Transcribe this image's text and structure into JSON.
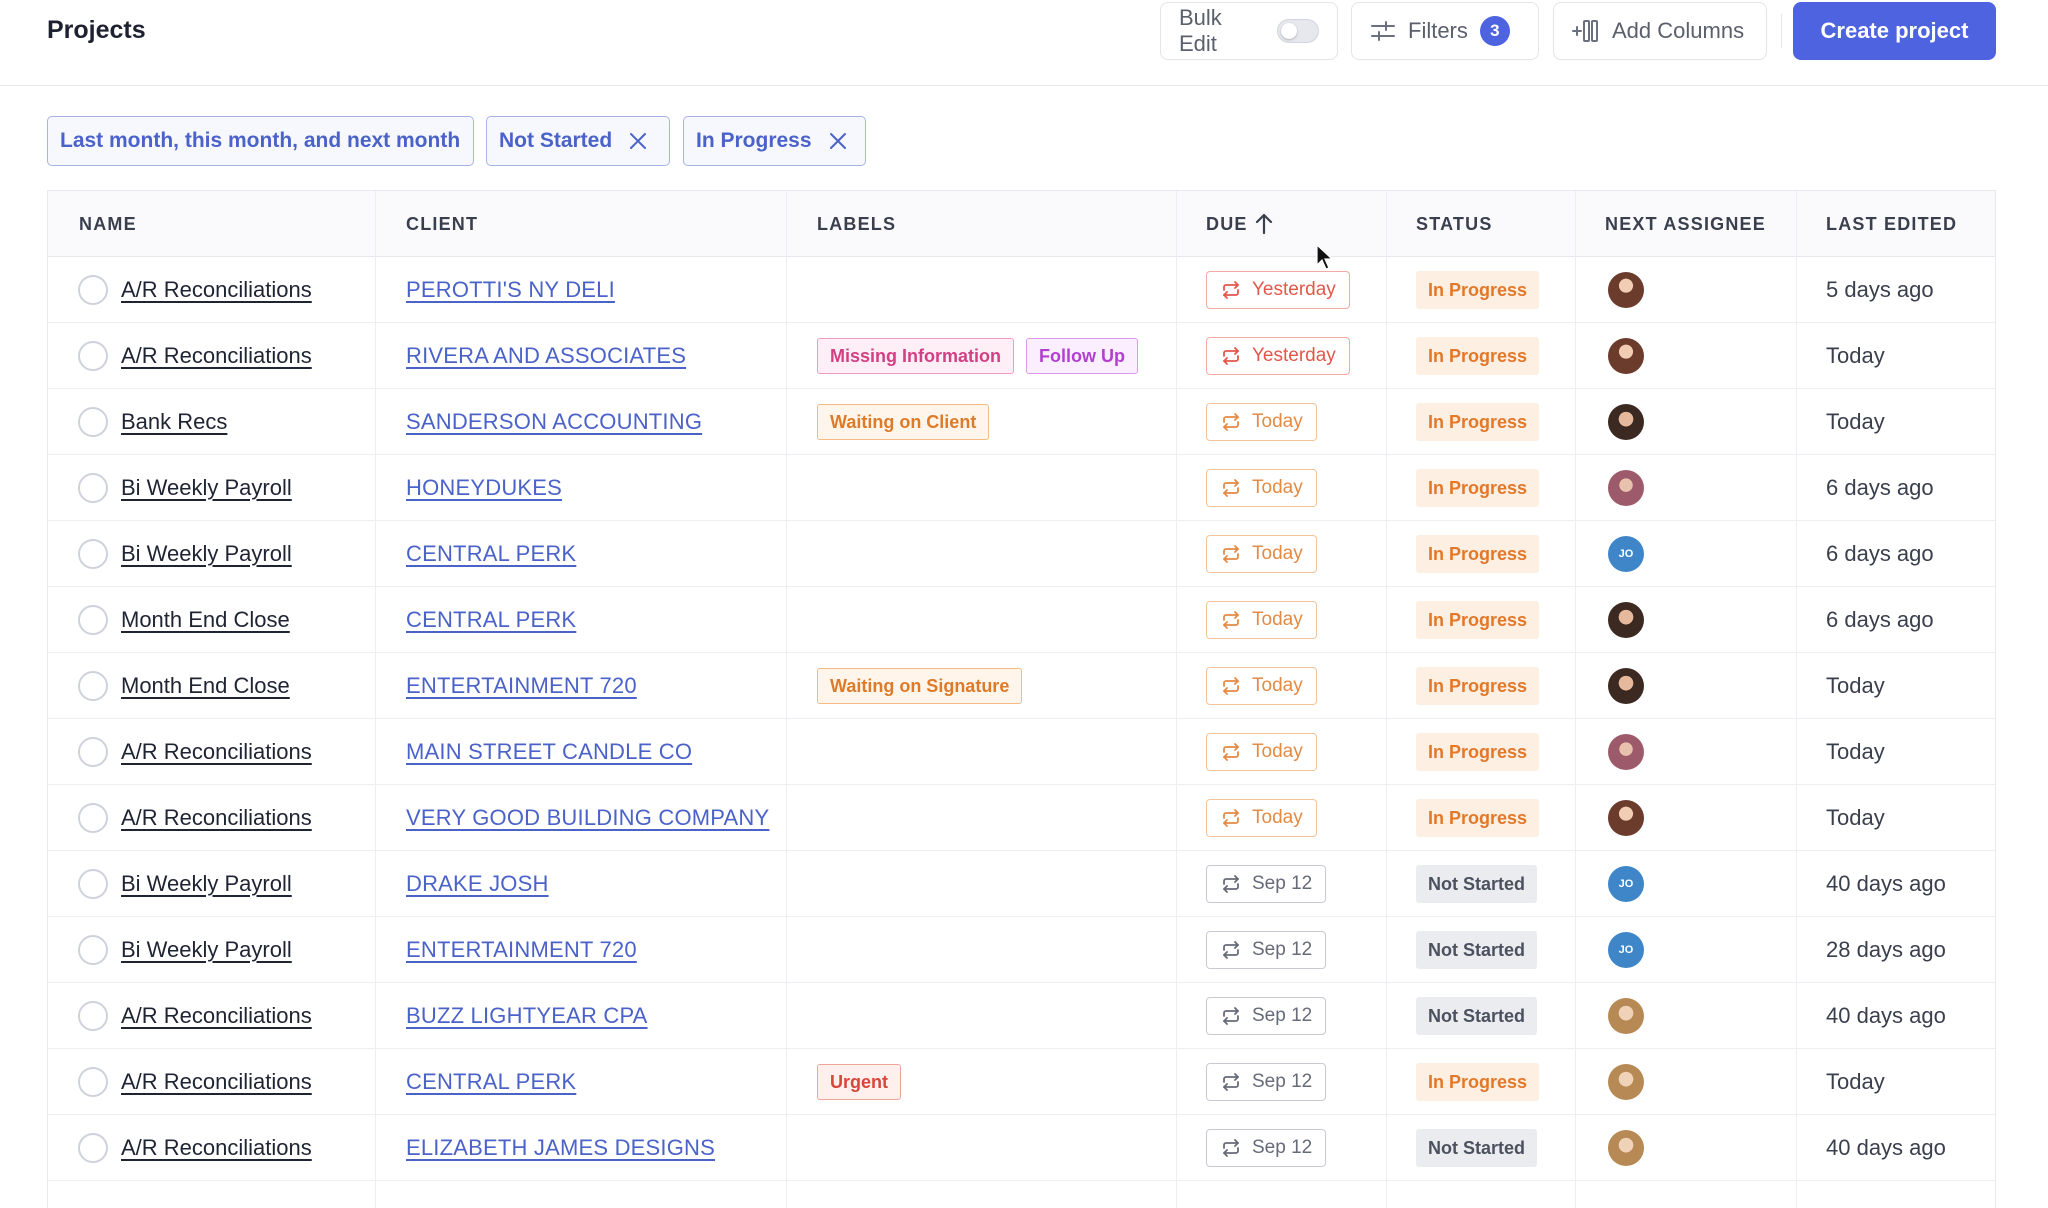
{
  "header": {
    "title": "Projects",
    "bulk_edit_label": "Bulk Edit",
    "filters_label": "Filters",
    "filters_count": "3",
    "add_columns_label": "Add Columns",
    "create_label": "Create project"
  },
  "chips": [
    {
      "label": "Last month, this month, and next month",
      "removable": false
    },
    {
      "label": "Not Started",
      "removable": true
    },
    {
      "label": "In Progress",
      "removable": true
    }
  ],
  "columns": {
    "name": "NAME",
    "client": "CLIENT",
    "labels": "LABELS",
    "due": "DUE",
    "status": "STATUS",
    "next_assignee": "NEXT ASSIGNEE",
    "last_edited": "LAST EDITED"
  },
  "rows": [
    {
      "name": "A/R Reconciliations",
      "client": "PEROTTI'S NY DELI",
      "labels": [],
      "due": "Yesterday",
      "due_tone": "red",
      "status": "In Progress",
      "assignee": "photo-a",
      "assignee_initials": "",
      "last_edited": "5 days ago"
    },
    {
      "name": "A/R Reconciliations",
      "client": "RIVERA AND ASSOCIATES",
      "labels": [
        {
          "text": "Missing Information",
          "tone": "pink"
        },
        {
          "text": "Follow Up",
          "tone": "violet"
        }
      ],
      "due": "Yesterday",
      "due_tone": "red",
      "status": "In Progress",
      "assignee": "photo-a",
      "assignee_initials": "",
      "last_edited": "Today"
    },
    {
      "name": "Bank Recs",
      "client": "SANDERSON ACCOUNTING",
      "labels": [
        {
          "text": "Waiting on Client",
          "tone": "orange"
        }
      ],
      "due": "Today",
      "due_tone": "orange",
      "status": "In Progress",
      "assignee": "photo-b",
      "assignee_initials": "",
      "last_edited": "Today"
    },
    {
      "name": "Bi Weekly Payroll",
      "client": "HONEYDUKES",
      "labels": [],
      "due": "Today",
      "due_tone": "orange",
      "status": "In Progress",
      "assignee": "photo-c",
      "assignee_initials": "",
      "last_edited": "6 days ago"
    },
    {
      "name": "Bi Weekly Payroll",
      "client": "CENTRAL PERK",
      "labels": [],
      "due": "Today",
      "due_tone": "orange",
      "status": "In Progress",
      "assignee": "initials",
      "assignee_initials": "JO",
      "last_edited": "6 days ago"
    },
    {
      "name": "Month End Close",
      "client": "CENTRAL PERK",
      "labels": [],
      "due": "Today",
      "due_tone": "orange",
      "status": "In Progress",
      "assignee": "photo-b",
      "assignee_initials": "",
      "last_edited": "6 days ago"
    },
    {
      "name": "Month End Close",
      "client": "ENTERTAINMENT 720",
      "labels": [
        {
          "text": "Waiting on Signature",
          "tone": "orange"
        }
      ],
      "due": "Today",
      "due_tone": "orange",
      "status": "In Progress",
      "assignee": "photo-b",
      "assignee_initials": "",
      "last_edited": "Today"
    },
    {
      "name": "A/R Reconciliations",
      "client": "MAIN STREET CANDLE CO",
      "labels": [],
      "due": "Today",
      "due_tone": "orange",
      "status": "In Progress",
      "assignee": "photo-c",
      "assignee_initials": "",
      "last_edited": "Today"
    },
    {
      "name": "A/R Reconciliations",
      "client": "VERY GOOD BUILDING COMPANY",
      "labels": [],
      "due": "Today",
      "due_tone": "orange",
      "status": "In Progress",
      "assignee": "photo-a",
      "assignee_initials": "",
      "last_edited": "Today"
    },
    {
      "name": "Bi Weekly Payroll",
      "client": "DRAKE JOSH",
      "labels": [],
      "due": "Sep 12",
      "due_tone": "gray",
      "status": "Not Started",
      "assignee": "initials",
      "assignee_initials": "JO",
      "last_edited": "40 days ago"
    },
    {
      "name": "Bi Weekly Payroll",
      "client": "ENTERTAINMENT 720",
      "labels": [],
      "due": "Sep 12",
      "due_tone": "gray",
      "status": "Not Started",
      "assignee": "initials",
      "assignee_initials": "JO",
      "last_edited": "28 days ago"
    },
    {
      "name": "A/R Reconciliations",
      "client": "BUZZ LIGHTYEAR CPA",
      "labels": [],
      "due": "Sep 12",
      "due_tone": "gray",
      "status": "Not Started",
      "assignee": "photo-d",
      "assignee_initials": "",
      "last_edited": "40 days ago"
    },
    {
      "name": "A/R Reconciliations",
      "client": "CENTRAL PERK",
      "labels": [
        {
          "text": "Urgent",
          "tone": "red"
        }
      ],
      "due": "Sep 12",
      "due_tone": "gray",
      "status": "In Progress",
      "assignee": "photo-d",
      "assignee_initials": "",
      "last_edited": "Today"
    },
    {
      "name": "A/R Reconciliations",
      "client": "ELIZABETH JAMES DESIGNS",
      "labels": [],
      "due": "Sep 12",
      "due_tone": "gray",
      "status": "Not Started",
      "assignee": "photo-d",
      "assignee_initials": "",
      "last_edited": "40 days ago"
    }
  ],
  "colors": {
    "accent": "#4d63e0",
    "link": "#4b62c9",
    "in_progress": "#e2782a",
    "overdue": "#e2574b"
  },
  "icons": {
    "filters": "sliders-icon",
    "add_columns": "add-columns-icon",
    "chip_remove": "close-icon",
    "due_sort": "arrow-up-icon",
    "due": "recurring-icon"
  }
}
